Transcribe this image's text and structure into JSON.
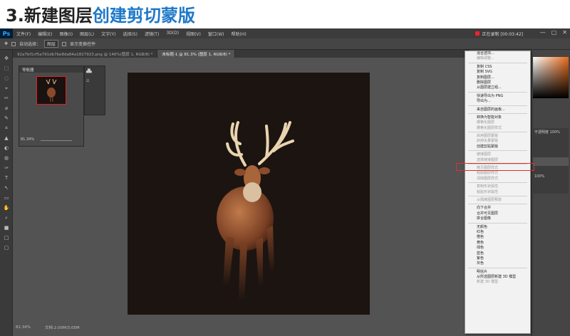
{
  "banner": {
    "number": "3.",
    "title": "新建图层",
    "title_highlight": "创建剪切蒙版"
  },
  "app": {
    "logo": "Ps",
    "menu": [
      "文件(F)",
      "编辑(E)",
      "图像(I)",
      "图层(L)",
      "文字(Y)",
      "选择(S)",
      "滤镜(T)",
      "3D(D)",
      "视图(V)",
      "窗口(W)",
      "帮助(H)"
    ],
    "recording": "正在录制 [00:03:42]",
    "window_controls": [
      "—",
      "▢",
      "✕"
    ]
  },
  "options": {
    "auto_select": "自动选择：",
    "auto_select_value": "图层",
    "transform": "显示变换控件"
  },
  "tabs": [
    {
      "label": "92a7bf1cf5a791db7be8da84a1827923.png @ 146%(图层 1, RGB/8) *",
      "active": false
    },
    {
      "label": "未标题-1 @ 81.3% (图层 1, RGB/8) *",
      "active": true
    }
  ],
  "navigator": {
    "title": "导航器",
    "zoom": "81.34%"
  },
  "status": {
    "zoom": "81.34%",
    "doc": "文档:2.00M/3.05M"
  },
  "right_panel": {
    "opacity_label": "不透明度",
    "opacity": "100%",
    "fill": "100%"
  },
  "context_menu": {
    "highlighted": "创建剪贴蒙版",
    "items": [
      {
        "label": "混合选项...",
        "dim": false
      },
      {
        "label": "编辑调整...",
        "dim": true
      },
      {
        "sep": true
      },
      {
        "label": "复制 CSS",
        "dim": false
      },
      {
        "label": "复制 SVG",
        "dim": false
      },
      {
        "label": "复制图层...",
        "dim": false
      },
      {
        "label": "删除图层",
        "dim": false
      },
      {
        "label": "从图层建立组...",
        "dim": false
      },
      {
        "sep": true
      },
      {
        "label": "快速导出为 PNG",
        "dim": false
      },
      {
        "label": "导出为...",
        "dim": false
      },
      {
        "sep": true
      },
      {
        "label": "来自图层的画板...",
        "dim": false
      },
      {
        "sep": true
      },
      {
        "label": "转换为智能对象",
        "dim": false
      },
      {
        "label": "栅格化图层",
        "dim": true
      },
      {
        "label": "栅格化图层样式",
        "dim": true
      },
      {
        "sep": true
      },
      {
        "label": "启用图层蒙版",
        "dim": true
      },
      {
        "label": "启用矢量蒙版",
        "dim": true
      },
      {
        "label": "创建剪贴蒙版",
        "dim": false
      },
      {
        "sep": true
      },
      {
        "label": "链接图层",
        "dim": true
      },
      {
        "label": "选择链接图层",
        "dim": true
      },
      {
        "sep": true
      },
      {
        "label": "拷贝图层样式",
        "dim": true
      },
      {
        "label": "粘贴图层样式",
        "dim": true
      },
      {
        "label": "清除图层样式",
        "dim": true
      },
      {
        "sep": true
      },
      {
        "label": "复制形状属性",
        "dim": true
      },
      {
        "label": "粘贴形状属性",
        "dim": true
      },
      {
        "sep": true
      },
      {
        "label": "从隔离图层释放",
        "dim": true
      },
      {
        "sep": true
      },
      {
        "label": "向下合并",
        "dim": false
      },
      {
        "label": "合并可见图层",
        "dim": false
      },
      {
        "label": "拼合图像",
        "dim": false
      },
      {
        "sep": true
      },
      {
        "label": "无颜色",
        "dim": false
      },
      {
        "label": "红色",
        "dim": false
      },
      {
        "label": "橙色",
        "dim": false
      },
      {
        "label": "黄色",
        "dim": false
      },
      {
        "label": "绿色",
        "dim": false
      },
      {
        "label": "蓝色",
        "dim": false
      },
      {
        "label": "紫色",
        "dim": false
      },
      {
        "label": "灰色",
        "dim": false
      },
      {
        "sep": true
      },
      {
        "label": "明信片",
        "dim": false
      },
      {
        "label": "从所选图层新建 3D 模型",
        "dim": false
      },
      {
        "label": "新建 3D 模型",
        "dim": true
      }
    ]
  }
}
